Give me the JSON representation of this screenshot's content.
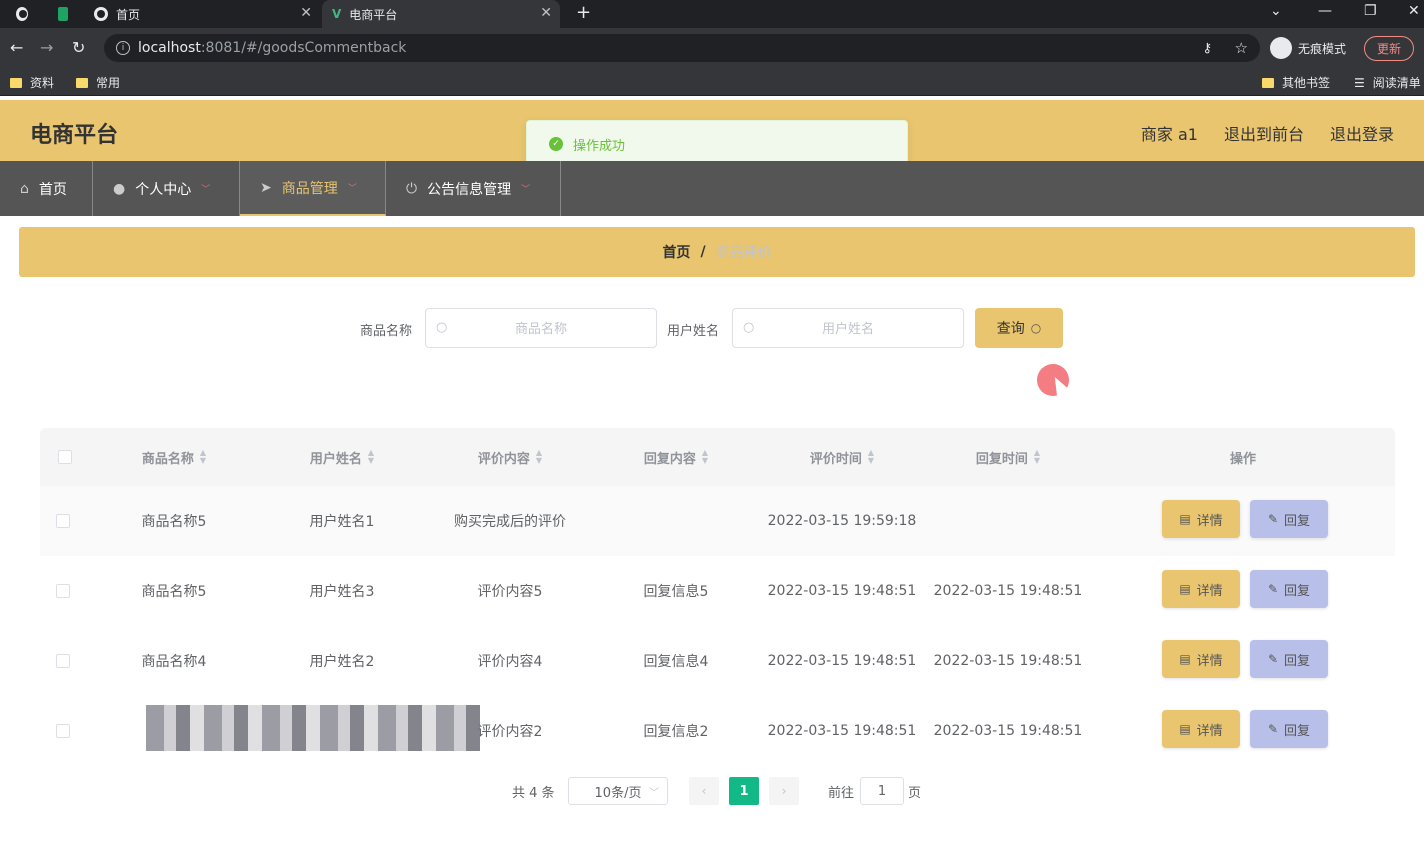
{
  "browser": {
    "tabs": [
      {
        "title": "首页"
      },
      {
        "title": "电商平台"
      }
    ],
    "url_host": "localhost",
    "url_path": ":8081/#/goodsCommentback",
    "incognito_label": "无痕模式",
    "update_label": "更新",
    "bookmarks": [
      "资料",
      "常用"
    ],
    "bookmarks_right": [
      "其他书签",
      "阅读清单"
    ]
  },
  "header": {
    "brand": "电商平台",
    "links": [
      "商家 a1",
      "退出到前台",
      "退出登录"
    ]
  },
  "toast": {
    "message": "操作成功"
  },
  "menu": [
    {
      "label": "首页",
      "icon": "home-icon"
    },
    {
      "label": "个人中心",
      "icon": "user-icon"
    },
    {
      "label": "商品管理",
      "icon": "send-icon"
    },
    {
      "label": "公告信息管理",
      "icon": "power-icon"
    }
  ],
  "breadcrumb": {
    "home": "首页",
    "sep": "/",
    "current": "商品评价"
  },
  "search": {
    "goods_label": "商品名称",
    "goods_placeholder": "商品名称",
    "user_label": "用户姓名",
    "user_placeholder": "用户姓名",
    "query_label": "查询"
  },
  "table": {
    "columns": [
      "商品名称",
      "用户姓名",
      "评价内容",
      "回复内容",
      "评价时间",
      "回复时间",
      "操作"
    ],
    "rows": [
      {
        "goods": "商品名称5",
        "user": "用户姓名1",
        "comment": "购买完成后的评价",
        "reply": "",
        "comment_time": "2022-03-15 19:59:18",
        "reply_time": ""
      },
      {
        "goods": "商品名称5",
        "user": "用户姓名3",
        "comment": "评价内容5",
        "reply": "回复信息5",
        "comment_time": "2022-03-15 19:48:51",
        "reply_time": "2022-03-15 19:48:51"
      },
      {
        "goods": "商品名称4",
        "user": "用户姓名2",
        "comment": "评价内容4",
        "reply": "回复信息4",
        "comment_time": "2022-03-15 19:48:51",
        "reply_time": "2022-03-15 19:48:51"
      },
      {
        "goods": "",
        "user": "",
        "comment": "评价内容2",
        "reply": "回复信息2",
        "comment_time": "2022-03-15 19:48:51",
        "reply_time": "2022-03-15 19:48:51"
      }
    ],
    "detail_label": "详情",
    "reply_label": "回复"
  },
  "pagination": {
    "total": "共 4 条",
    "page_size": "10条/页",
    "current_page": "1",
    "goto_label": "前往",
    "goto_value": "1",
    "page_suffix": "页"
  },
  "colors": {
    "accent": "#e8c56e",
    "menu_bg": "#555555",
    "reply_btn": "#b8bfe8",
    "pager_active": "#12b886"
  }
}
